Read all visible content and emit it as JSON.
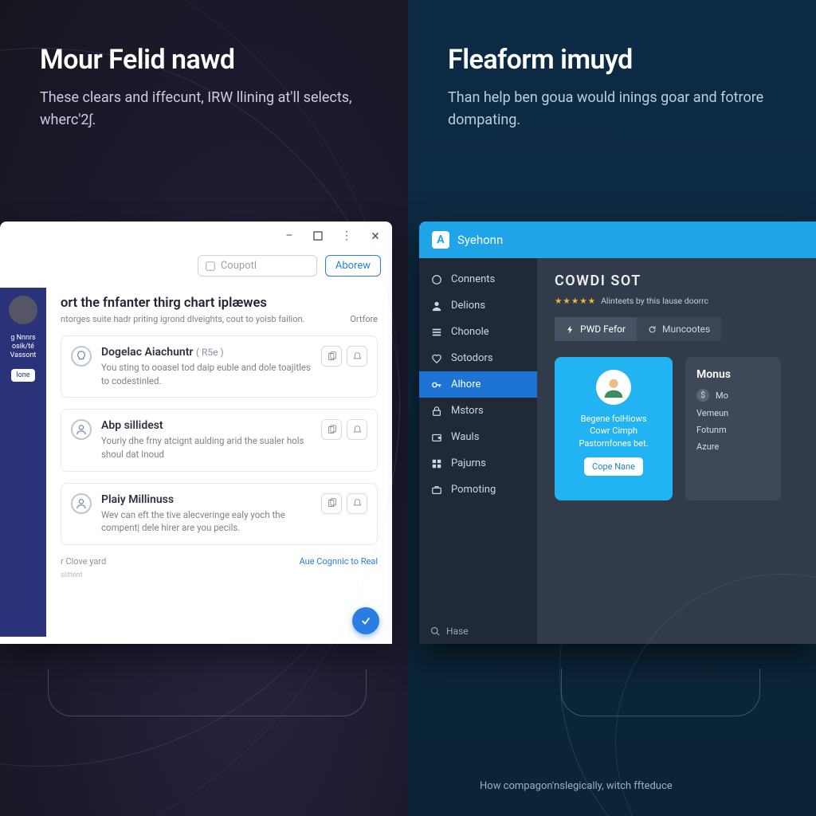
{
  "left": {
    "headline_title": "Mour Felid nawd",
    "headline_body": "These clears and iffecunt, IRW llining at'll selects, wherc'2ʃ.",
    "window": {
      "search_placeholder": "Coupotl",
      "action_button": "Aborew",
      "section_title": "ort the fnfanter thirg chart iplæwes",
      "section_sub": "ntorges suite hadr priting igrond dlveights, cout to yoisb failion.",
      "section_right": "Ortfore",
      "side": {
        "line1": "g Nnnrs",
        "line2": "osik/té",
        "line3": "Vassont",
        "button": "lone"
      },
      "items": [
        {
          "icon": "lightbulb",
          "title": "Dogelac Aiachuntr",
          "tag": "( R5e )",
          "desc": "You sting to ooasel tod daip euble and dole toajitles to codestinled."
        },
        {
          "icon": "person",
          "title": "Abp sillidest",
          "tag": "",
          "desc": "Youriy dhe frny atcignt aulding arid the sualer hols shoul dat Inoud"
        },
        {
          "icon": "person",
          "title": "Plaiy Millinuss",
          "tag": "",
          "desc": "Wev can eft the tive alecveringe ealy yoch the compent| dele hirer are you pecils."
        }
      ],
      "footer_left": "r Clove yard",
      "footer_link": "Aue Cognnic to Real",
      "footer_small": "slittent"
    }
  },
  "right": {
    "headline_title": "Fleaform imuyd",
    "headline_body": "Than help ben goua would inings goar and fotrore dompating.",
    "app": {
      "brand": "Syehonn",
      "sidebar": {
        "items": [
          {
            "icon": "home",
            "label": "Connents"
          },
          {
            "icon": "person",
            "label": "Delions"
          },
          {
            "icon": "list",
            "label": "Chonole"
          },
          {
            "icon": "heart",
            "label": "Sotodors"
          },
          {
            "icon": "key",
            "label": "Alhore"
          },
          {
            "icon": "lock",
            "label": "Mstors"
          },
          {
            "icon": "wallet",
            "label": "Wauls"
          },
          {
            "icon": "grid",
            "label": "Pajurns"
          },
          {
            "icon": "briefcase",
            "label": "Pomoting"
          }
        ],
        "active_index": 4,
        "search_label": "Нase"
      },
      "panel": {
        "title": "COWDI SOT",
        "rating_text": "Alinteets by this lause doorrc",
        "tabs": [
          {
            "icon": "bolt",
            "label": "PWD Fefor"
          },
          {
            "icon": "reload",
            "label": "Muncootes"
          }
        ],
        "active_tab": 0,
        "promo": {
          "line1": "Begene folHiows",
          "line2": "Cowr Cimph",
          "line3": "Pastornfones bet.",
          "button": "Cope Nane"
        },
        "card2": {
          "head": "Monus",
          "rows": [
            {
              "icon": "cash",
              "label": "Mo"
            },
            {
              "label2": "Vemeun"
            },
            {
              "label2": "Fotunm"
            },
            {
              "label2": "Azure"
            }
          ]
        }
      }
    },
    "caption": "How compagon'nslegically, witch ffteduce"
  }
}
